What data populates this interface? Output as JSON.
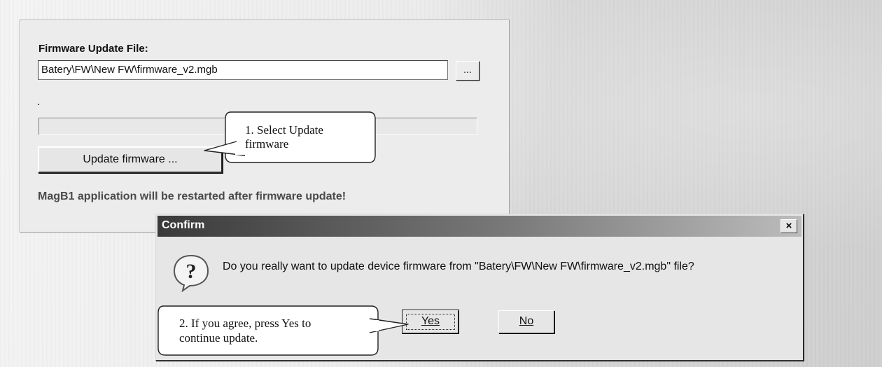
{
  "firmware_panel": {
    "label": "Firmware Update File:",
    "file_path": "Batery\\FW\\New FW\\firmware_v2.mgb",
    "browse_label": "...",
    "status_text": ".",
    "progress": 0,
    "update_button_label": "Update firmware ...",
    "restart_note": "MagB1 application will be restarted after firmware update!"
  },
  "callouts": {
    "step1_line1": "1. Select Update",
    "step1_line2": "firmware",
    "step2_line1": "2. If you agree, press Yes to",
    "step2_line2": "continue update."
  },
  "confirm_dialog": {
    "title": "Confirm",
    "close_label": "×",
    "icon": "question-icon",
    "message": "Do you really want to update device firmware from \"Batery\\FW\\New FW\\firmware_v2.mgb\" file?",
    "yes_label": "Yes",
    "no_label": "No"
  }
}
